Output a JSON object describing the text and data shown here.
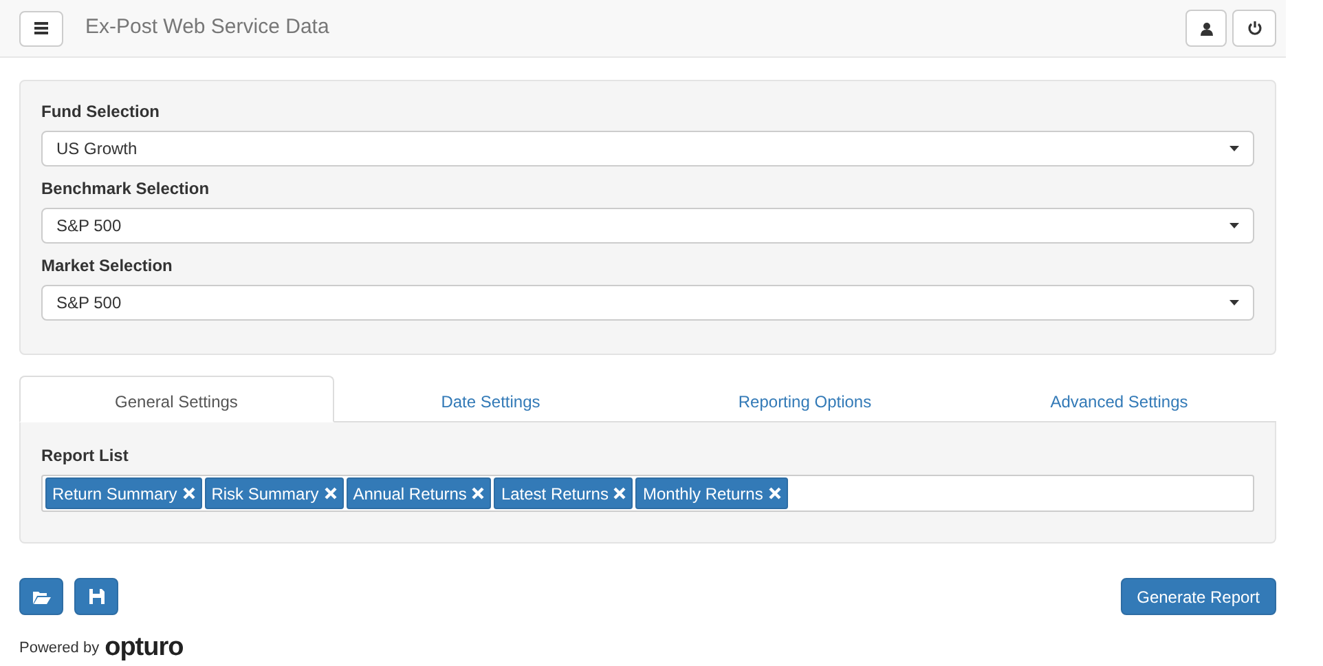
{
  "navbar": {
    "title": "Ex-Post Web Service Data"
  },
  "selections": [
    {
      "label": "Fund Selection",
      "value": "US Growth"
    },
    {
      "label": "Benchmark Selection",
      "value": "S&P 500"
    },
    {
      "label": "Market Selection",
      "value": "S&P 500"
    }
  ],
  "tabs": [
    {
      "label": "General Settings",
      "selected": true
    },
    {
      "label": "Date Settings",
      "selected": false
    },
    {
      "label": "Reporting Options",
      "selected": false
    },
    {
      "label": "Advanced Settings",
      "selected": false
    }
  ],
  "report_list": {
    "label": "Report List",
    "tags": [
      "Return Summary",
      "Risk Summary",
      "Annual Returns",
      "Latest Returns",
      "Monthly Returns"
    ]
  },
  "generate_button": "Generate Report",
  "footer": {
    "powered_by": "Powered by",
    "logo": "opturo"
  }
}
